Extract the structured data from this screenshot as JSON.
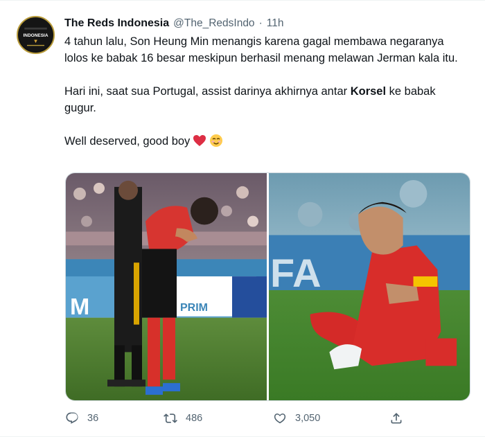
{
  "tweet": {
    "author": {
      "display_name": "The Reds Indonesia",
      "handle": "@The_RedsIndo",
      "separator": "·",
      "timestamp": "11h",
      "avatar_text": "INDONESIA"
    },
    "text": {
      "line1": "4 tahun lalu, Son Heung Min menangis karena gagal membawa negaranya lolos ke babak 16 besar meskipun berhasil menang melawan Jerman kala itu.",
      "line2_before": "Hari ini, saat sua Portugal, assist darinya akhirnya antar ",
      "line2_bold": "Korsel",
      "line2_after": " ke babak gugur.",
      "line3": "Well deserved, good boy"
    },
    "media": {
      "left_photo_text": "M",
      "left_photo_text2": "PRIM",
      "right_photo_text": "FA"
    },
    "actions": {
      "replies": "36",
      "retweets": "486",
      "likes": "3,050"
    }
  },
  "colors": {
    "text_primary": "#0f1419",
    "text_secondary": "#536471",
    "border": "#cfd9de",
    "heart": "#dd2e44"
  },
  "icons": {
    "reply": "reply-icon",
    "retweet": "retweet-icon",
    "like": "heart-icon",
    "share": "share-icon"
  }
}
